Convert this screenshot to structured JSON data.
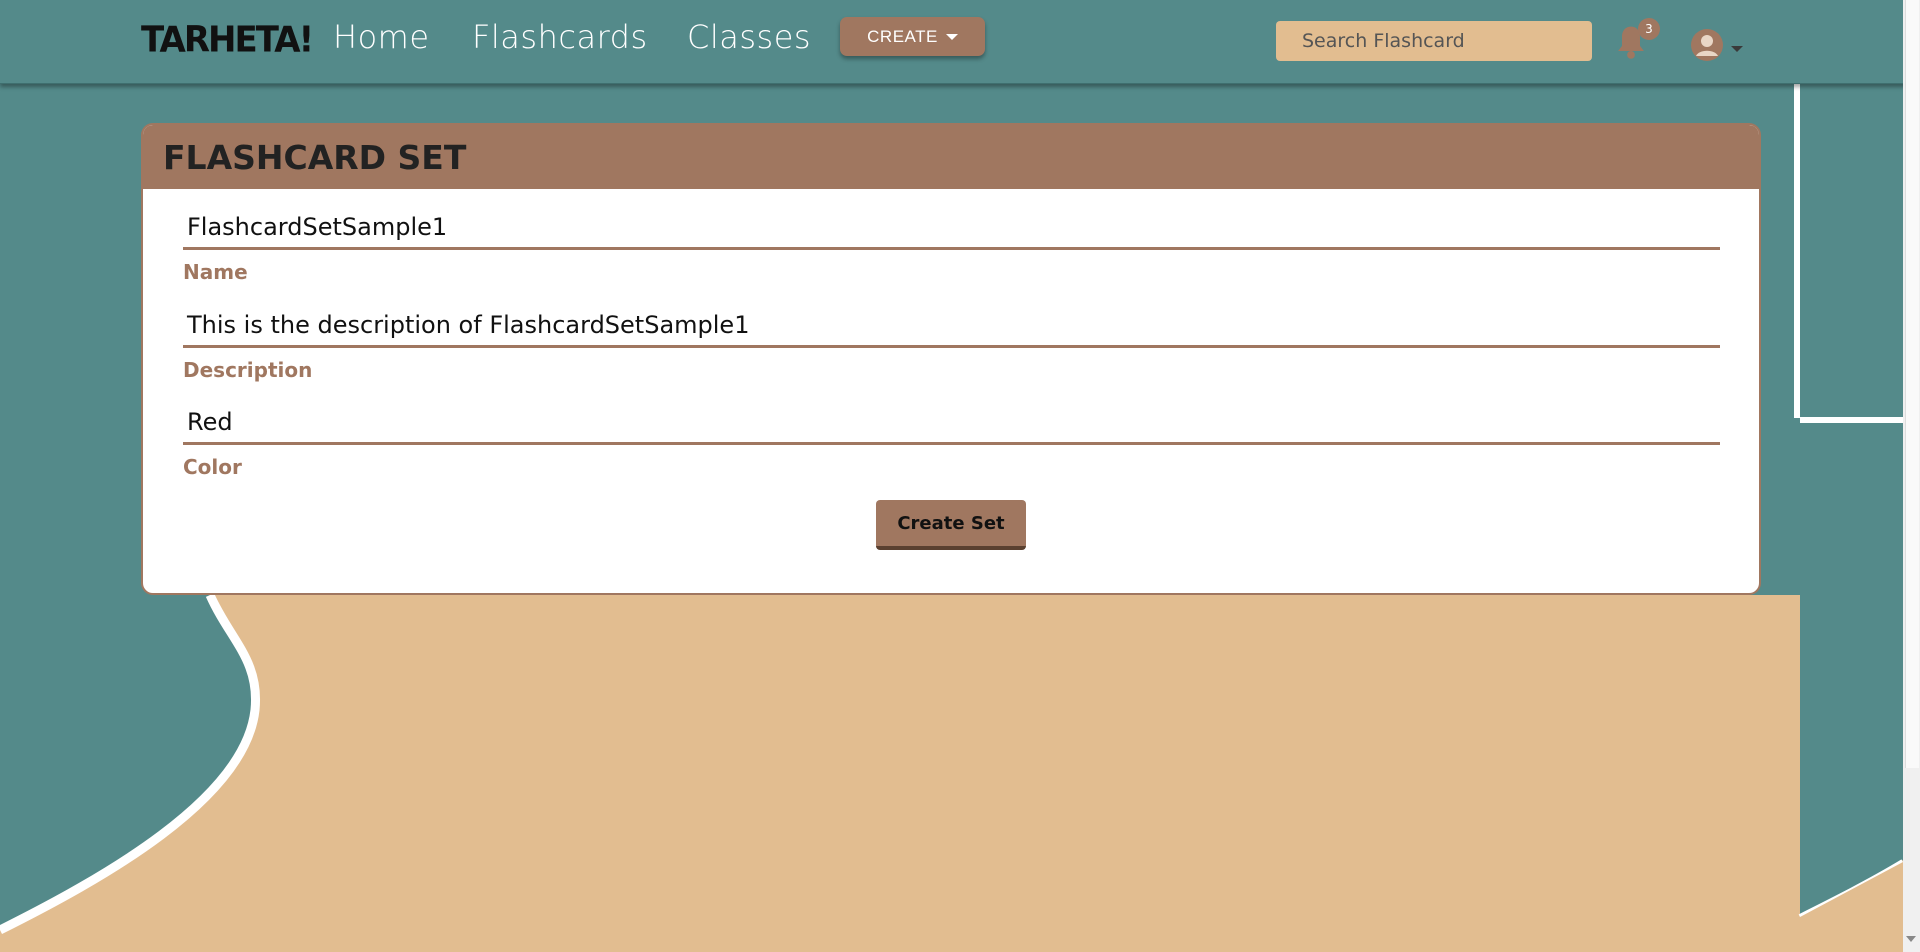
{
  "nav": {
    "logo": "TARHETA!",
    "links": [
      "Home",
      "Flashcards",
      "Classes"
    ],
    "create_label": "CREATE",
    "search_placeholder": "Search Flashcard",
    "notification_count": "3"
  },
  "card": {
    "title": "FLASHCARD SET",
    "fields": [
      {
        "value": "FlashcardSetSample1",
        "label": "Name"
      },
      {
        "value": "This is the description of FlashcardSetSample1",
        "label": "Description"
      },
      {
        "value": "Red",
        "label": "Color"
      }
    ],
    "submit_label": "Create Set"
  },
  "colors": {
    "teal": "#548a8a",
    "tan": "#e2bd90",
    "brown": "#a07760"
  }
}
